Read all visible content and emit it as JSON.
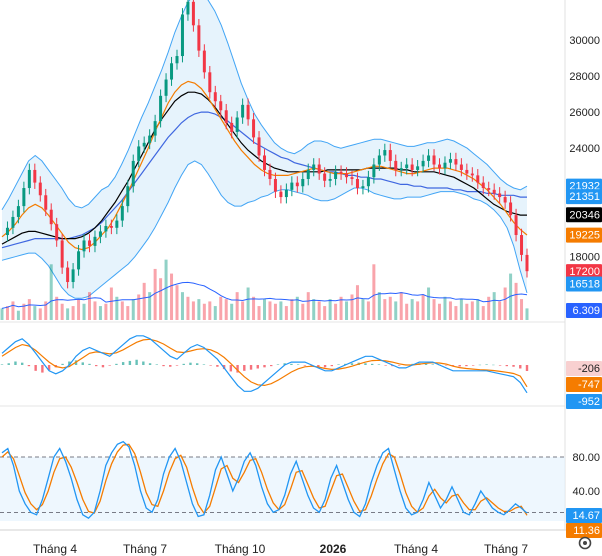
{
  "chart_data": [
    {
      "type": "line",
      "panel": "price",
      "y_ticks": [
        "30000",
        "28000",
        "26000",
        "24000",
        "18000"
      ],
      "y_tick_values": [
        30000,
        28000,
        26000,
        24000,
        18000
      ],
      "ylim": [
        14500,
        32200
      ],
      "series": [
        {
          "kind": "candles",
          "values": [
            19200,
            19600,
            20200,
            20800,
            21800,
            22800,
            22100,
            21400,
            20600,
            19800,
            18900,
            17400,
            16600,
            17300,
            18300,
            18900,
            18600,
            19100,
            19400,
            19700,
            19600,
            20000,
            20800,
            21900,
            23300,
            24100,
            24300,
            24700,
            25500,
            26900,
            27800,
            28700,
            29100,
            31400,
            32100,
            30800,
            29400,
            28200,
            27100,
            26600,
            26100,
            25400,
            24900,
            25700,
            26400,
            25600,
            24600,
            23600,
            22800,
            22300,
            21600,
            21300,
            21700,
            22100,
            21900,
            22300,
            22800,
            23100,
            22600,
            22200,
            22300,
            22700,
            22600,
            22400,
            22300,
            21800,
            21900,
            22400,
            23100,
            23600,
            23900,
            23300,
            22800,
            22900,
            23100,
            22800,
            23000,
            23300,
            23600,
            23100,
            22900,
            23200,
            23400,
            23100,
            22800,
            22600,
            22500,
            22100,
            21800,
            21700,
            21500,
            21300,
            21000,
            20300,
            19200,
            18100,
            17200
          ]
        },
        {
          "kind": "bollinger_upper",
          "values": [
            20600,
            21200,
            21900,
            22600,
            23300,
            23600,
            23300,
            22800,
            22300,
            21800,
            21200,
            20800,
            20700,
            20900,
            21300,
            21700,
            21900,
            22400,
            23100,
            23900,
            24800,
            25700,
            26500,
            27400,
            28300,
            29300,
            30400,
            31300,
            32100,
            32500,
            32600,
            32200,
            31600,
            30800,
            29800,
            28700,
            27600,
            26700,
            25900,
            25300,
            24800,
            24300,
            24000,
            23800,
            23700,
            23900,
            24200,
            24400,
            24400,
            24300,
            24100,
            24000,
            24100,
            24200,
            24300,
            24400,
            24500,
            24500,
            24400,
            24300,
            24200,
            24100,
            24100,
            24200,
            24300,
            24300,
            24400,
            24500,
            24400,
            24200,
            24000,
            23700,
            23400,
            23100,
            22700,
            22300,
            22000,
            21800,
            21700,
            21900
          ]
        },
        {
          "kind": "bollinger_lower",
          "values": [
            17800,
            17900,
            18000,
            18100,
            18200,
            18200,
            17900,
            17500,
            16900,
            16300,
            15900,
            15700,
            15700,
            15800,
            16100,
            16400,
            16700,
            17000,
            17300,
            17600,
            18000,
            18500,
            19000,
            19600,
            20300,
            21000,
            21800,
            22500,
            23100,
            23300,
            23100,
            22600,
            22000,
            21400,
            21000,
            20800,
            20800,
            21000,
            21100,
            21300,
            21400,
            21600,
            21700,
            21700,
            21600,
            21500,
            21400,
            21200,
            21100,
            21100,
            21200,
            21400,
            21600,
            21800,
            21800,
            21700,
            21500,
            21400,
            21300,
            21200,
            21200,
            21300,
            21300,
            21300,
            21400,
            21500,
            21600,
            21600,
            21600,
            21500,
            21400,
            21200,
            21100,
            20900,
            20600,
            20200,
            19600,
            18600,
            17200,
            16000
          ]
        },
        {
          "kind": "ma_orange",
          "values": [
            19100,
            19400,
            19800,
            20300,
            20700,
            20900,
            20700,
            20300,
            19800,
            19300,
            18800,
            18500,
            18400,
            18500,
            18800,
            19200,
            19600,
            20200,
            20900,
            21600,
            22400,
            23200,
            24000,
            24900,
            25700,
            26500,
            27100,
            27500,
            27700,
            27600,
            27300,
            26800,
            26200,
            25600,
            25000,
            24400,
            23900,
            23500,
            23100,
            22800,
            22600,
            22500,
            22500,
            22500,
            22600,
            22700,
            22800,
            22900,
            22800,
            22700,
            22600,
            22600,
            22600,
            22700,
            22800,
            22900,
            23000,
            23000,
            22900,
            22800,
            22700,
            22600,
            22600,
            22700,
            22800,
            22900,
            22900,
            22900,
            22800,
            22700,
            22500,
            22300,
            22000,
            21700,
            21300,
            20900,
            20400,
            19900,
            19500,
            19200
          ]
        },
        {
          "kind": "ma_black",
          "values": [
            18700,
            18900,
            19100,
            19300,
            19400,
            19400,
            19300,
            19200,
            19100,
            19000,
            19000,
            19000,
            19100,
            19300,
            19600,
            20000,
            20500,
            21000,
            21600,
            22200,
            22900,
            23600,
            24300,
            25000,
            25600,
            26100,
            26600,
            26900,
            27100,
            27100,
            27000,
            26700,
            26300,
            25800,
            25300,
            24800,
            24300,
            23900,
            23600,
            23300,
            23100,
            22900,
            22800,
            22700,
            22700,
            22700,
            22700,
            22700,
            22700,
            22800,
            22800,
            22800,
            22800,
            22800,
            22800,
            22900,
            22900,
            22900,
            22900,
            22900,
            22800,
            22800,
            22700,
            22700,
            22700,
            22700,
            22600,
            22500,
            22400,
            22200,
            22000,
            21800,
            21500,
            21200,
            20900,
            20700,
            20500,
            20400,
            20300,
            20300
          ]
        },
        {
          "kind": "ma_blue",
          "values": [
            18500,
            18600,
            18700,
            18800,
            18900,
            19000,
            19000,
            19000,
            19000,
            19000,
            19000,
            19100,
            19200,
            19400,
            19600,
            19900,
            20300,
            20700,
            21100,
            21600,
            22100,
            22600,
            23100,
            23600,
            24100,
            24600,
            25000,
            25400,
            25700,
            25900,
            26000,
            26000,
            25900,
            25700,
            25500,
            25200,
            24900,
            24600,
            24300,
            24100,
            23900,
            23700,
            23500,
            23400,
            23200,
            23100,
            23000,
            22900,
            22800,
            22700,
            22700,
            22600,
            22500,
            22500,
            22400,
            22400,
            22300,
            22300,
            22200,
            22100,
            22000,
            22000,
            21900,
            21900,
            21800,
            21800,
            21800,
            21800,
            21700,
            21700,
            21600,
            21600,
            21600,
            21500,
            21500,
            21400,
            21400,
            21400,
            21300,
            21300
          ]
        }
      ],
      "price_badges": [
        {
          "label": "21932",
          "value": 21932,
          "color": "#2196f3"
        },
        {
          "label": "21351",
          "value": 21351,
          "color": "#2196f3"
        },
        {
          "label": "20346",
          "value": 20346,
          "color": "#000000"
        },
        {
          "label": "19225",
          "value": 19225,
          "color": "#f57c00"
        },
        {
          "label": "17200",
          "value": 17200,
          "color": "#f23645"
        },
        {
          "label": "16518",
          "value": 16518,
          "color": "#2196f3"
        }
      ]
    },
    {
      "type": "bar",
      "panel": "volume",
      "badge": {
        "label": "6.309",
        "color": "#2962ff"
      },
      "values": [
        5,
        6,
        8,
        4,
        7,
        9,
        6,
        5,
        8,
        24,
        10,
        7,
        5,
        6,
        9,
        7,
        12,
        8,
        6,
        7,
        14,
        10,
        8,
        6,
        9,
        11,
        16,
        12,
        22,
        18,
        26,
        20,
        15,
        12,
        10,
        8,
        9,
        7,
        8,
        6,
        10,
        9,
        7,
        12,
        8,
        14,
        10,
        6,
        9,
        8,
        7,
        8,
        6,
        9,
        10,
        7,
        12,
        9,
        8,
        6,
        9,
        7,
        10,
        8,
        11,
        15,
        9,
        8,
        24,
        12,
        9,
        10,
        8,
        12,
        7,
        9,
        8,
        11,
        14,
        9,
        7,
        10,
        8,
        6,
        9,
        7,
        8,
        9,
        6,
        10,
        12,
        8,
        14,
        20,
        16,
        9,
        5
      ]
    },
    {
      "type": "bar",
      "panel": "macd",
      "badges": [
        {
          "label": "-206",
          "color": "#f8d0d0",
          "text_color": "#222"
        },
        {
          "label": "-747",
          "color": "#f57c00",
          "text_color": "#ffffff"
        },
        {
          "label": "-952",
          "color": "#2196f3",
          "text_color": "#ffffff"
        }
      ],
      "histogram": [
        20,
        60,
        120,
        80,
        -40,
        -200,
        -260,
        -180,
        -80,
        40,
        120,
        160,
        90,
        40,
        -40,
        -80,
        -20,
        40,
        100,
        140,
        180,
        120,
        60,
        20,
        -40,
        -60,
        -20,
        40,
        80,
        60,
        20,
        -20,
        -60,
        -140,
        -220,
        -260,
        -200,
        -160,
        -120,
        -80,
        -40,
        20,
        60,
        40,
        20,
        -20,
        -40,
        -60,
        -80,
        -40,
        20,
        40,
        60,
        80,
        60,
        40,
        20,
        -20,
        -40,
        -20,
        20,
        40,
        60,
        40,
        20,
        10,
        -10,
        -30,
        -50,
        -40,
        -20,
        10,
        20,
        10,
        -20,
        -40,
        -60,
        -120,
        -206
      ],
      "macd_line": [
        400,
        600,
        800,
        900,
        700,
        400,
        100,
        -200,
        -300,
        -200,
        0,
        300,
        500,
        600,
        500,
        400,
        300,
        500,
        700,
        900,
        1000,
        1000,
        900,
        700,
        500,
        300,
        200,
        400,
        600,
        700,
        600,
        400,
        200,
        -100,
        -400,
        -700,
        -900,
        -900,
        -800,
        -600,
        -400,
        -200,
        0,
        100,
        100,
        100,
        0,
        -100,
        -200,
        -200,
        -100,
        0,
        100,
        200,
        300,
        300,
        200,
        100,
        0,
        -100,
        -100,
        0,
        100,
        100,
        100,
        0,
        -100,
        -200,
        -200,
        -200,
        -200,
        -200,
        -200,
        -250,
        -300,
        -350,
        -400,
        -600,
        -952
      ],
      "signal_line": [
        300,
        450,
        600,
        700,
        650,
        500,
        300,
        100,
        -50,
        -100,
        -50,
        100,
        250,
        400,
        450,
        420,
        380,
        420,
        520,
        650,
        780,
        860,
        880,
        820,
        720,
        580,
        450,
        430,
        480,
        540,
        560,
        520,
        420,
        260,
        50,
        -180,
        -400,
        -580,
        -680,
        -700,
        -640,
        -520,
        -380,
        -240,
        -130,
        -60,
        -40,
        -70,
        -120,
        -150,
        -140,
        -100,
        -40,
        30,
        100,
        150,
        160,
        140,
        100,
        40,
        0,
        0,
        30,
        60,
        80,
        70,
        30,
        -40,
        -90,
        -120,
        -140,
        -160,
        -170,
        -190,
        -220,
        -250,
        -290,
        -380,
        -747
      ],
      "ylim": [
        -1200,
        1200
      ]
    },
    {
      "type": "line",
      "panel": "stochastic",
      "y_ticks": [
        "80.00",
        "40.00"
      ],
      "y_tick_values": [
        80,
        40
      ],
      "ylim": [
        0,
        100
      ],
      "badges": [
        {
          "label": "14.67",
          "value": 14.67,
          "color": "#2196f3"
        },
        {
          "label": "11.36",
          "value": 11.36,
          "color": "#f57c00"
        }
      ],
      "k_line": [
        85,
        90,
        70,
        40,
        25,
        15,
        12,
        30,
        55,
        80,
        90,
        75,
        55,
        30,
        12,
        8,
        15,
        40,
        70,
        85,
        95,
        98,
        92,
        70,
        40,
        20,
        15,
        30,
        60,
        80,
        90,
        75,
        50,
        25,
        10,
        12,
        35,
        65,
        80,
        60,
        40,
        55,
        75,
        85,
        70,
        45,
        25,
        15,
        18,
        35,
        60,
        75,
        55,
        35,
        20,
        15,
        30,
        55,
        70,
        50,
        30,
        15,
        10,
        25,
        50,
        70,
        85,
        90,
        65,
        40,
        20,
        12,
        15,
        30,
        50,
        35,
        20,
        30,
        45,
        30,
        15,
        12,
        25,
        40,
        30,
        20,
        15,
        12,
        18,
        25,
        20,
        14
      ],
      "d_line": [
        80,
        86,
        78,
        58,
        38,
        25,
        18,
        24,
        40,
        62,
        78,
        80,
        68,
        50,
        30,
        16,
        14,
        28,
        52,
        72,
        86,
        94,
        95,
        84,
        62,
        38,
        24,
        22,
        40,
        62,
        78,
        82,
        68,
        44,
        24,
        14,
        22,
        44,
        66,
        70,
        55,
        50,
        62,
        76,
        78,
        62,
        42,
        26,
        18,
        24,
        42,
        62,
        64,
        48,
        32,
        20,
        22,
        40,
        58,
        60,
        44,
        28,
        16,
        18,
        34,
        54,
        72,
        84,
        80,
        60,
        38,
        22,
        15,
        20,
        34,
        42,
        32,
        26,
        34,
        36,
        26,
        18,
        18,
        28,
        32,
        26,
        20,
        16,
        16,
        20,
        22,
        11.36
      ],
      "band": [
        40,
        80
      ]
    }
  ],
  "x_axis": {
    "labels": [
      "Tháng 4",
      "Tháng 7",
      "Tháng 10",
      "2026",
      "Tháng 4",
      "Tháng 7"
    ],
    "bold_index": 3
  },
  "colors": {
    "up": "#089981",
    "down": "#f23645",
    "band_fill": "#dbeefb",
    "band_line": "#42a5f5",
    "orange": "#f57c00",
    "black": "#000000",
    "blue": "#3f67e0"
  },
  "icons": {
    "settings": "gear-icon"
  }
}
